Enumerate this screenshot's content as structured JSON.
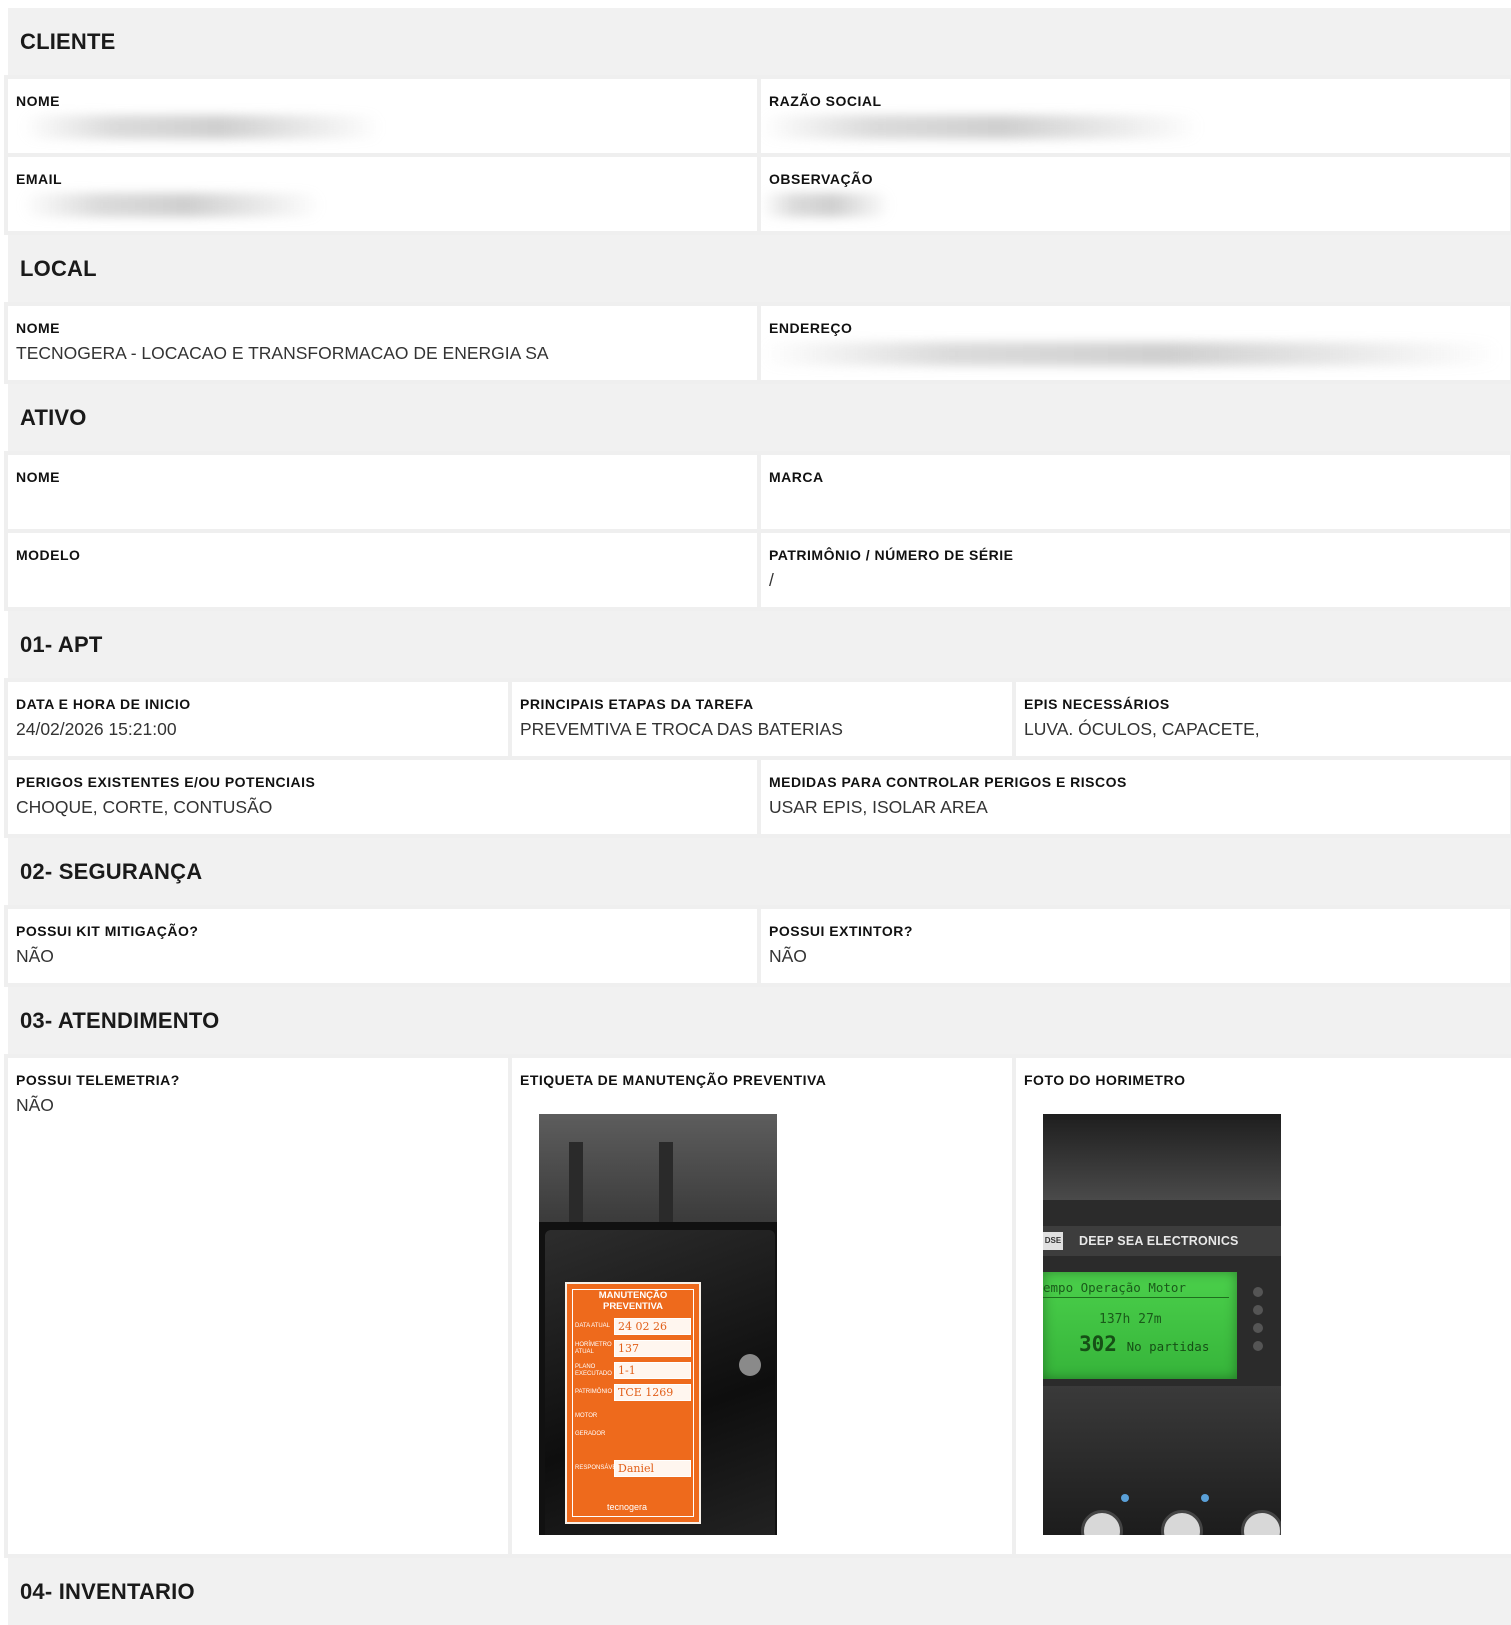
{
  "sections": {
    "cliente": "CLIENTE",
    "local": "LOCAL",
    "ativo": "ATIVO",
    "apt": "01- APT",
    "seguranca": "02- SEGURANÇA",
    "atendimento": "03- ATENDIMENTO",
    "inventario": "04- INVENTARIO"
  },
  "cliente": {
    "nome_label": "NOME",
    "razao_label": "RAZÃO SOCIAL",
    "email_label": "EMAIL",
    "obs_label": "OBSERVAÇÃO"
  },
  "local": {
    "nome_label": "NOME",
    "nome_value": "TECNOGERA - LOCACAO E TRANSFORMACAO DE ENERGIA SA",
    "endereco_label": "ENDEREÇO"
  },
  "ativo": {
    "nome_label": "NOME",
    "marca_label": "MARCA",
    "modelo_label": "MODELO",
    "patrimonio_label": "PATRIMÔNIO / NÚMERO DE SÉRIE",
    "patrimonio_value": "/"
  },
  "apt": {
    "data_label": "DATA E HORA DE INICIO",
    "data_value": "24/02/2026 15:21:00",
    "etapas_label": "PRINCIPAIS ETAPAS DA TAREFA",
    "etapas_value": "PREVEMTIVA E TROCA DAS BATERIAS",
    "epis_label": "EPIS NECESSÁRIOS",
    "epis_value": "LUVA. ÓCULOS, CAPACETE,",
    "perigos_label": "PERIGOS EXISTENTES E/OU POTENCIAIS",
    "perigos_value": "CHOQUE, CORTE, CONTUSÃO",
    "medidas_label": "MEDIDAS PARA CONTROLAR PERIGOS E RISCOS",
    "medidas_value": "USAR EPIS, ISOLAR AREA"
  },
  "seguranca": {
    "kit_label": "POSSUI KIT MITIGAÇÃO?",
    "kit_value": "NÃO",
    "extintor_label": "POSSUI EXTINTOR?",
    "extintor_value": "NÃO"
  },
  "atendimento": {
    "telemetria_label": "POSSUI TELEMETRIA?",
    "telemetria_value": "NÃO",
    "etiqueta_label": "ETIQUETA DE MANUTENÇÃO PREVENTIVA",
    "foto_label": "FOTO DO HORIMETRO"
  },
  "tag_photo": {
    "title_line1": "MANUTENÇÃO",
    "title_line2": "PREVENTIVA",
    "f1_key": "DATA ATUAL",
    "f1_val": "24 02 26",
    "f2_key": "HORÍMETRO ATUAL",
    "f2_val": "137",
    "f3_key": "PLANO EXECUTADO",
    "f3_val": "1-1",
    "f4_key": "PATRIMÔNIO",
    "f4_val": "TCE 1269",
    "f5_key": "MOTOR",
    "f6_key": "GERADOR",
    "f7_key": "RESPONSÁVEL",
    "f7_val": "Daniel",
    "logo": "tecnogera"
  },
  "meter_photo": {
    "dse": "DSE",
    "brand": "DEEP SEA ELECTRONICS",
    "line1": "empo Operação Motor",
    "line2": "137h 27m",
    "count": "302",
    "count_label": "No partidas"
  }
}
